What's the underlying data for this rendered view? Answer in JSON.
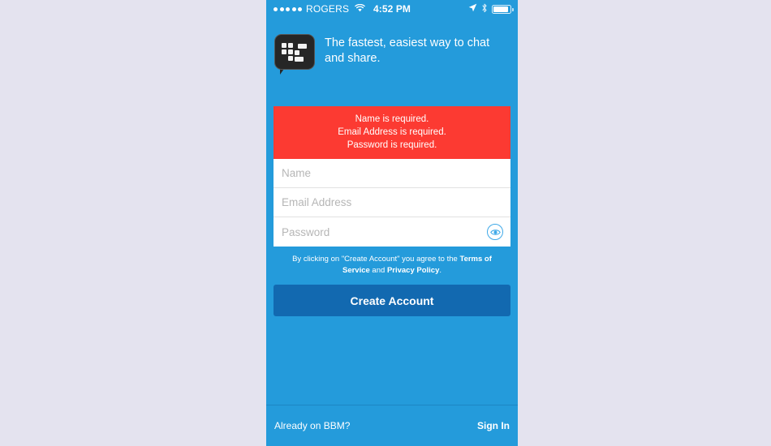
{
  "status_bar": {
    "signal_dots": 5,
    "carrier": "ROGERS",
    "wifi_icon": "wifi-icon",
    "time": "4:52 PM",
    "location_icon": "location-arrow-icon",
    "bluetooth_icon": "bluetooth-icon",
    "battery_icon": "battery-icon"
  },
  "header": {
    "logo_icon": "bbm-logo-icon",
    "tagline": "The fastest, easiest way to chat and share."
  },
  "errors": {
    "messages": [
      "Name is required.",
      "Email Address is required.",
      "Password is required."
    ]
  },
  "form": {
    "name": {
      "placeholder": "Name",
      "value": ""
    },
    "email": {
      "placeholder": "Email Address",
      "value": ""
    },
    "password": {
      "placeholder": "Password",
      "value": "",
      "reveal_icon": "eye-icon"
    }
  },
  "terms": {
    "prefix": "By clicking on \"Create Account\" you agree to the ",
    "terms_link": "Terms of Service",
    "conjunction": " and ",
    "privacy_link": "Privacy Policy",
    "suffix": "."
  },
  "actions": {
    "create_account": "Create Account"
  },
  "footer": {
    "prompt": "Already on BBM?",
    "sign_in": "Sign In"
  },
  "colors": {
    "app_background": "#249bdb",
    "error_red": "#fc3a32",
    "button_blue": "#1269b0",
    "page_background": "#e4e3ef",
    "logo_dark": "#262626",
    "accent_eye": "#3fa9e8"
  }
}
